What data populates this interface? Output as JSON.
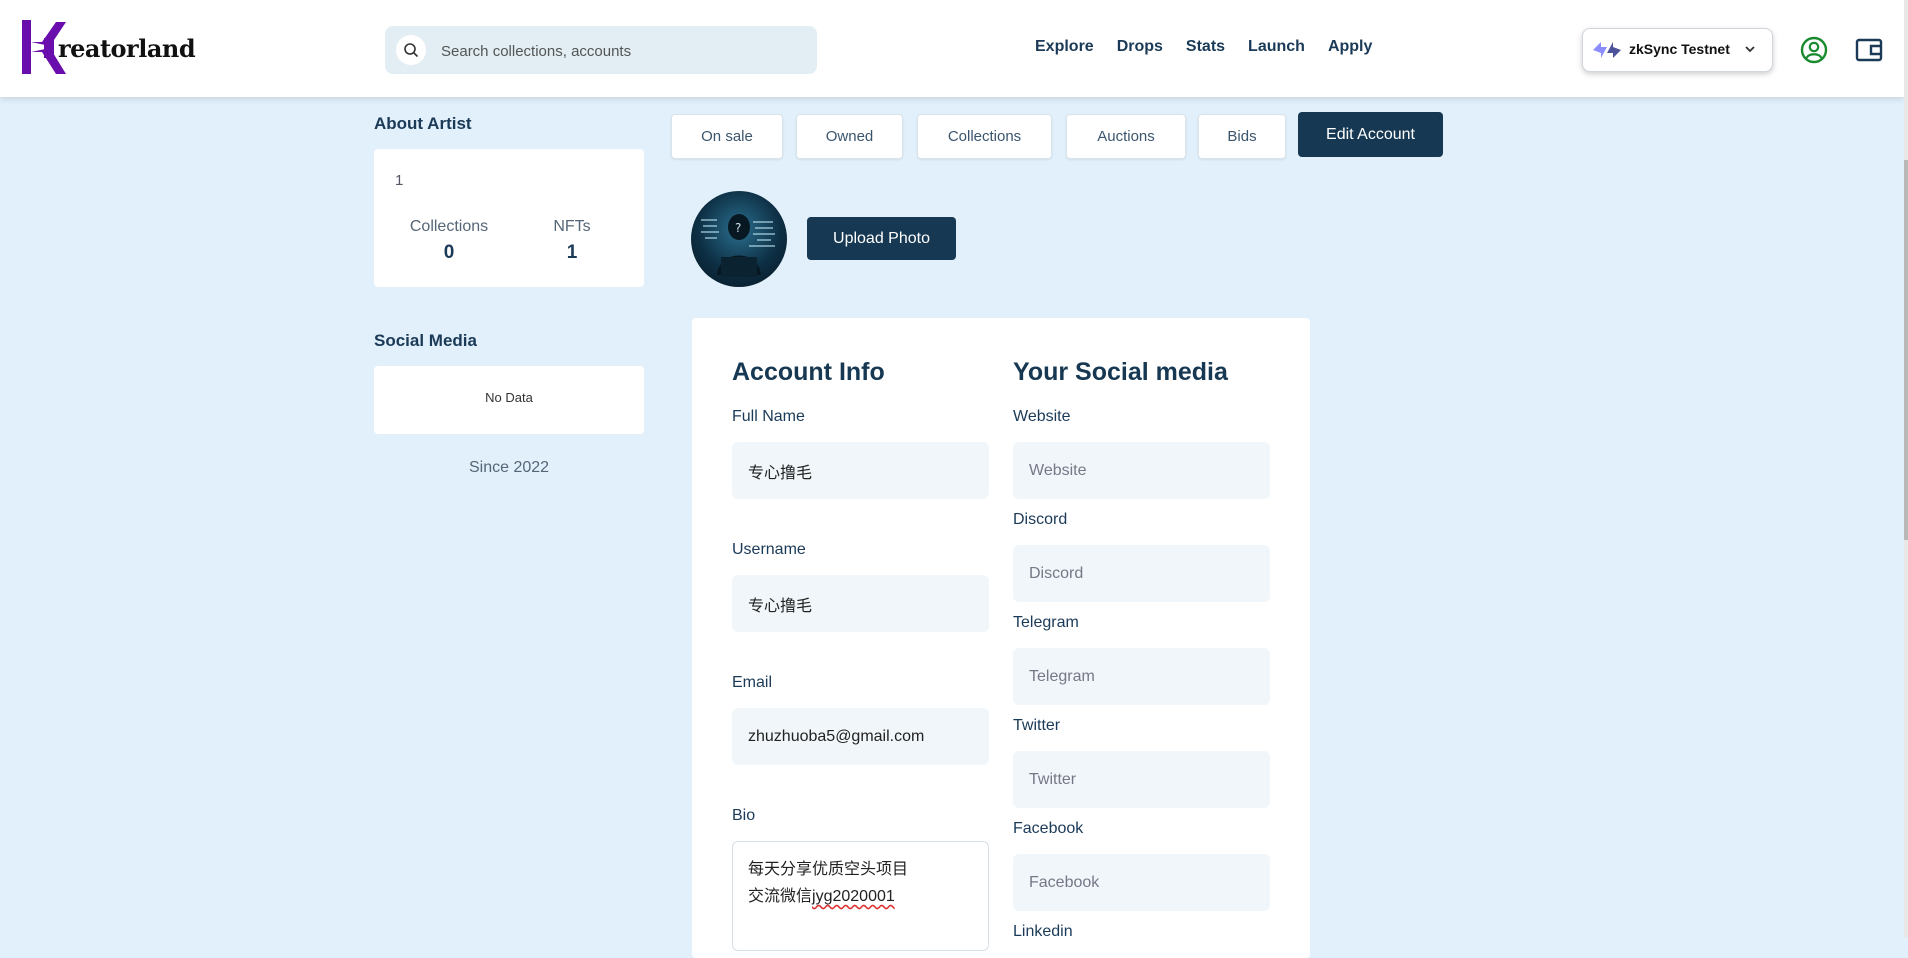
{
  "brand": {
    "logo_text": "reatorland",
    "logo_letter": "K",
    "accent": "#6a0dad"
  },
  "search": {
    "placeholder": "Search collections, accounts"
  },
  "nav": {
    "items": [
      "Explore",
      "Drops",
      "Stats",
      "Launch",
      "Apply"
    ]
  },
  "network": {
    "label": "zkSync Testnet"
  },
  "about": {
    "title": "About Artist",
    "number": "1",
    "collections_label": "Collections",
    "collections_value": "0",
    "nfts_label": "NFTs",
    "nfts_value": "1"
  },
  "social": {
    "title": "Social Media",
    "empty": "No Data",
    "since": "Since 2022"
  },
  "tabs": [
    "On sale",
    "Owned",
    "Collections",
    "Auctions",
    "Bids"
  ],
  "edit_account_label": "Edit Account",
  "upload_label": "Upload Photo",
  "account": {
    "title": "Account Info",
    "full_name_label": "Full Name",
    "full_name_value": "专心撸毛",
    "username_label": "Username",
    "username_value": "专心撸毛",
    "email_label": "Email",
    "email_value": "zhuzhuoba5@gmail.com",
    "bio_label": "Bio",
    "bio_line1": "每天分享优质空头项目",
    "bio_line2_prefix": "交流微信",
    "bio_line2_id": "jyg2020001"
  },
  "social_form": {
    "title": "Your Social media",
    "website_label": "Website",
    "website_placeholder": "Website",
    "discord_label": "Discord",
    "discord_placeholder": "Discord",
    "telegram_label": "Telegram",
    "telegram_placeholder": "Telegram",
    "twitter_label": "Twitter",
    "twitter_placeholder": "Twitter",
    "facebook_label": "Facebook",
    "facebook_placeholder": "Facebook",
    "linkedin_label": "Linkedin"
  }
}
